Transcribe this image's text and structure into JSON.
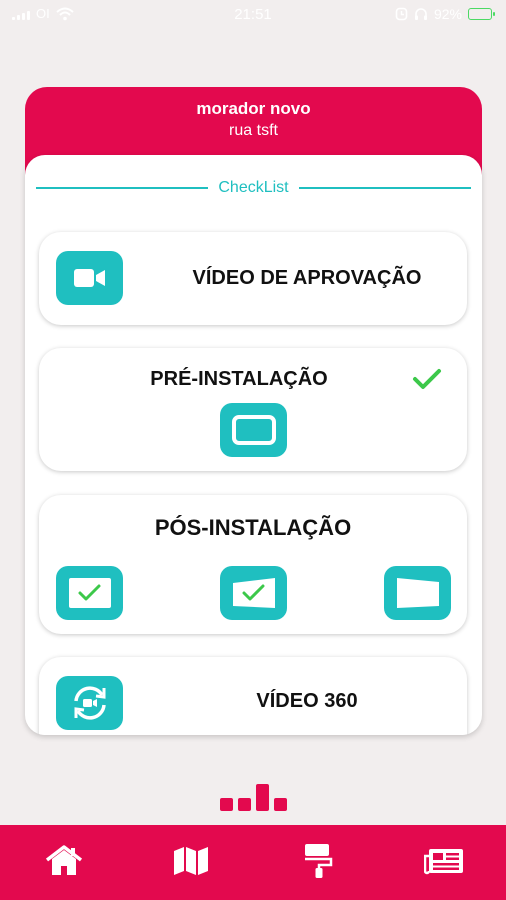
{
  "status_bar": {
    "time": "21:51",
    "battery": "92%",
    "icons": [
      "signal-icon",
      "carrier-icon",
      "wifi-icon",
      "alarm-icon",
      "headphones-icon",
      "battery-icon"
    ]
  },
  "header": {
    "resident_name": "morador novo",
    "address": "rua tsft"
  },
  "checklist": {
    "title": "CheckList",
    "items": [
      {
        "title": "VÍDEO DE APROVAÇÃO",
        "icon": "video-camera-icon"
      },
      {
        "title": "PRÉ-INSTALAÇÃO",
        "icon": "screen-frame-icon",
        "completed": true
      },
      {
        "title": "PÓS-INSTALAÇÃO",
        "icons": [
          "screen-check-icon",
          "screen-tilt-check-icon",
          "screen-skew-icon"
        ],
        "checked": [
          true,
          true,
          false
        ]
      },
      {
        "title": "VÍDEO 360",
        "icon": "video-360-icon"
      }
    ]
  },
  "page_indicator": {
    "count": 4,
    "active_index": 2
  },
  "tab_bar": {
    "items": [
      {
        "icon": "home-icon"
      },
      {
        "icon": "map-icon"
      },
      {
        "icon": "paint-roller-icon"
      },
      {
        "icon": "newspaper-icon"
      }
    ]
  },
  "colors": {
    "primary": "#e3094e",
    "accent": "#1fbfc0",
    "check": "#3cc84a",
    "background": "#f2eeee"
  }
}
